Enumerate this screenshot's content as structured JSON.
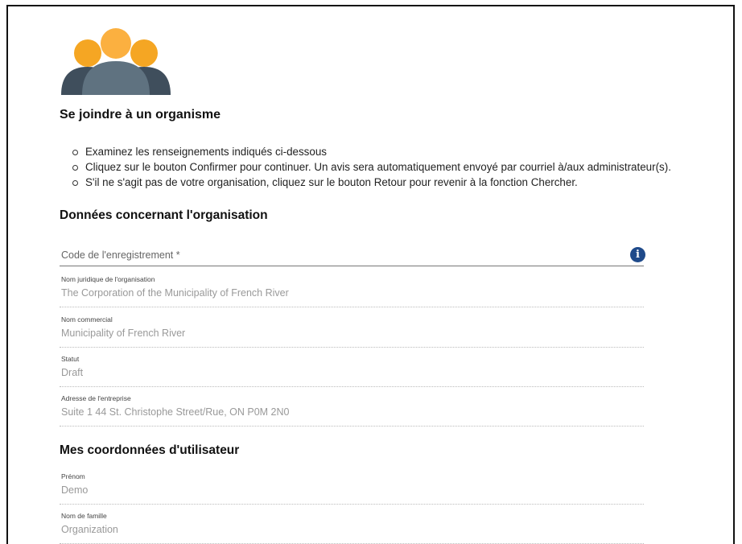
{
  "page": {
    "title": "Se joindre à un organisme",
    "logo_icon": "group-of-people-icon",
    "instructions": [
      "Examinez les renseignements indiqués ci-dessous",
      "Cliquez sur le bouton Confirmer pour continuer. Un avis sera automatiquement envoyé par courriel à/aux administrateur(s).",
      "S'il ne s'agit pas de votre organisation, cliquez sur le bouton Retour pour revenir à la fonction Chercher."
    ]
  },
  "org_section": {
    "title": "Données concernant l'organisation",
    "registration_code": {
      "label": "Code de l'enregistrement *",
      "value": "",
      "info_icon": "info-icon"
    },
    "fields": [
      {
        "label": "Nom juridique de l'organisation",
        "value": "The Corporation of the Municipality of French River"
      },
      {
        "label": "Nom commercial",
        "value": "Municipality of French River"
      },
      {
        "label": "Statut",
        "value": "Draft"
      },
      {
        "label": "Adresse de l'entreprise",
        "value": "Suite 1 44 St. Christophe Street/Rue, ON P0M 2N0"
      }
    ]
  },
  "user_section": {
    "title": "Mes coordonnées d'utilisateur",
    "fields": [
      {
        "label": "Prénom",
        "value": "Demo"
      },
      {
        "label": "Nom de famille",
        "value": "Organization"
      }
    ]
  },
  "colors": {
    "logo_orange": "#f5a623",
    "logo_orange_light": "#fbb040",
    "logo_slate": "#3f4e5c",
    "logo_slate_light": "#5f7280",
    "info_blue": "#1f4a8a"
  }
}
